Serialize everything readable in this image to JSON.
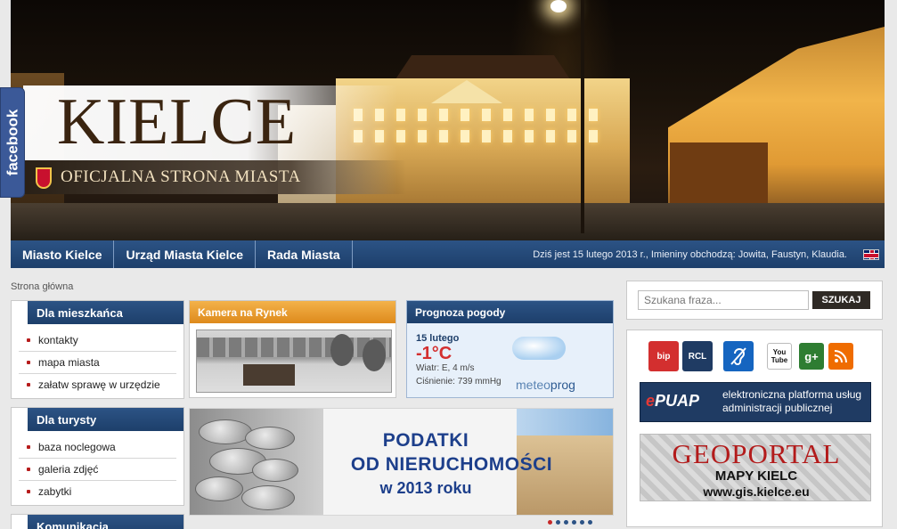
{
  "header": {
    "logo_title": "KIELCE",
    "logo_subtitle": "OFICJALNA STRONA MIASTA",
    "facebook_tab": "facebook"
  },
  "nav": {
    "items": [
      "Miasto Kielce",
      "Urząd Miasta Kielce",
      "Rada Miasta"
    ],
    "date_text": "Dziś jest 15 lutego 2013 r., Imieniny obchodzą: Jowita, Faustyn, Klaudia."
  },
  "breadcrumb": "Strona główna",
  "menus": {
    "residents": {
      "title": "Dla mieszkańca",
      "items": [
        "kontakty",
        "mapa miasta",
        "załatw sprawę w urzędzie"
      ]
    },
    "tourists": {
      "title": "Dla turysty",
      "items": [
        "baza noclegowa",
        "galeria zdjęć",
        "zabytki"
      ]
    },
    "transport": {
      "title": "Komunikacja"
    }
  },
  "camera": {
    "title": "Kamera na Rynek"
  },
  "weather": {
    "title": "Prognoza pogody",
    "date": "15 lutego",
    "temperature": "-1°C",
    "wind": "Wiatr: E, 4 m/s",
    "pressure": "Ciśnienie: 739 mmHg",
    "provider_prefix": "meteo",
    "provider_suffix": "prog"
  },
  "banner": {
    "line1": "PODATKI",
    "line2": "OD NIERUCHOMOŚCI",
    "line3": "w 2013 roku",
    "slide_count": 6,
    "active_slide": 1
  },
  "search": {
    "placeholder": "Szukana fraza...",
    "button_label": "SZUKAJ"
  },
  "links": {
    "bip": "bip",
    "rcl": "RCL",
    "youtube": "You Tube",
    "gplus": "g+",
    "epuap_logo_e": "e",
    "epuap_logo_rest": "PUAP",
    "epuap_text": "elektroniczna platforma usług administracji publicznej",
    "geoportal_title": "GEOPORTAL",
    "geoportal_sub": "MAPY KIELC",
    "geoportal_url": "www.gis.kielce.eu"
  },
  "colors": {
    "nav_blue": "#1d3f6b",
    "camera_orange": "#de8a1c",
    "temp_red": "#d32f2f",
    "bullet_red": "#b71c1c"
  }
}
